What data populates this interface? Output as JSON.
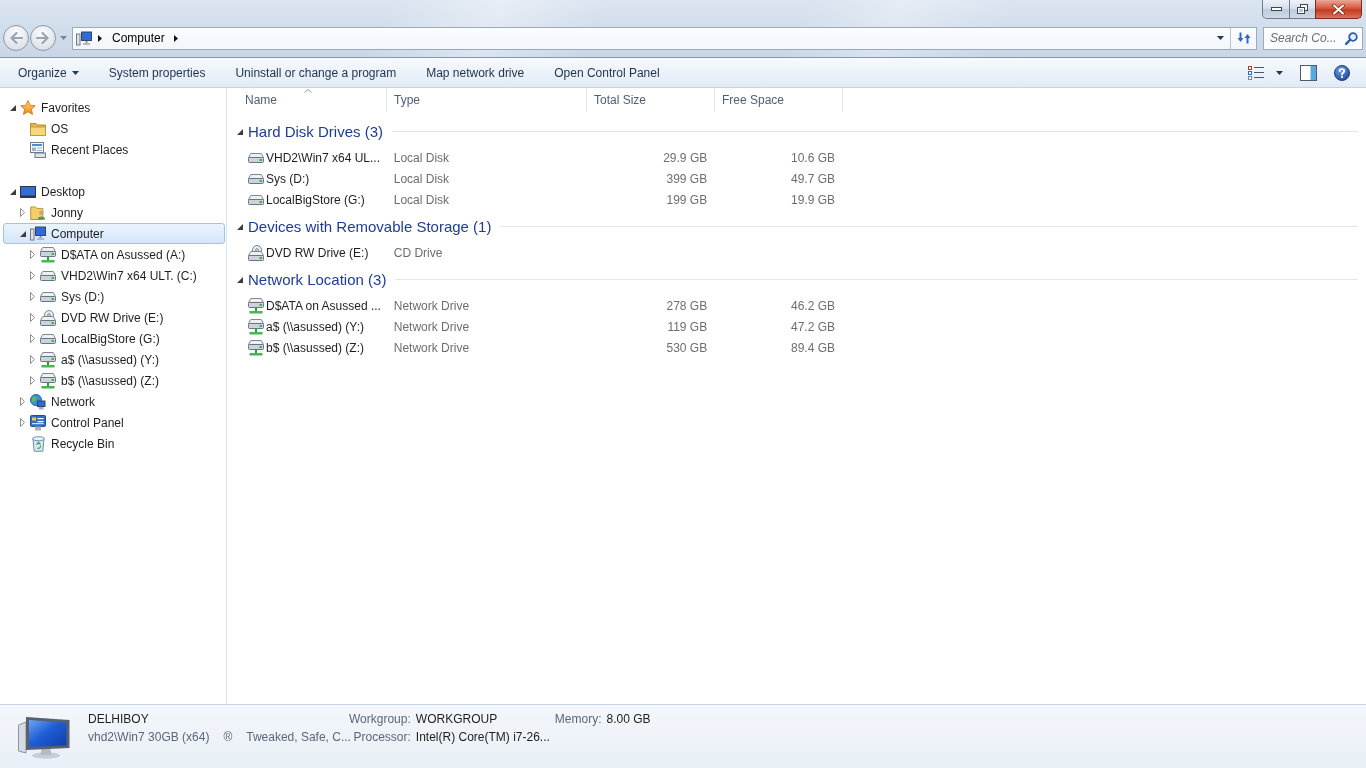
{
  "address_bar": {
    "nav_buttons": [
      {
        "kind": "back",
        "disabled": true
      },
      {
        "kind": "forward",
        "disabled": true
      }
    ],
    "crumbs": [
      {
        "label": "Computer"
      }
    ]
  },
  "search": {
    "placeholder": "Search Co..."
  },
  "command_bar": {
    "items": [
      {
        "label": "Organize",
        "kind": "menu"
      },
      {
        "label": "System properties",
        "kind": "button"
      },
      {
        "label": "Uninstall or change a program",
        "kind": "button"
      },
      {
        "label": "Map network drive",
        "kind": "button"
      },
      {
        "label": "Open Control Panel",
        "kind": "button"
      }
    ]
  },
  "navigation": {
    "sections": [
      {
        "label": "Favorites",
        "kind": "favorites",
        "expanded": true,
        "selected": false,
        "children": [
          {
            "label": "OS",
            "kind": "folder",
            "selected": false
          },
          {
            "label": "Recent Places",
            "kind": "recent",
            "selected": false
          }
        ]
      },
      {
        "label": "Desktop",
        "kind": "desktop",
        "expanded": true,
        "selected": false,
        "children": [
          {
            "label": "Jonny",
            "kind": "user-folder",
            "expanded": false,
            "selected": false
          },
          {
            "label": "Computer",
            "kind": "computer",
            "expanded": true,
            "selected": true,
            "children": [
              {
                "label": "D$ATA on Asussed (A:)",
                "kind": "network-drive",
                "expanded": false,
                "selected": false
              },
              {
                "label": "VHD2\\Win7 x64 ULT. (C:)",
                "kind": "disk",
                "expanded": false,
                "selected": false
              },
              {
                "label": "Sys (D:)",
                "kind": "disk",
                "expanded": false,
                "selected": false
              },
              {
                "label": "DVD RW Drive (E:)",
                "kind": "dvd",
                "expanded": false,
                "selected": false
              },
              {
                "label": "LocalBigStore (G:)",
                "kind": "disk",
                "expanded": false,
                "selected": false
              },
              {
                "label": "a$ (\\\\asussed) (Y:)",
                "kind": "network-drive",
                "expanded": false,
                "selected": false
              },
              {
                "label": "b$ (\\\\asussed) (Z:)",
                "kind": "network-drive",
                "expanded": false,
                "selected": false
              }
            ]
          },
          {
            "label": "Network",
            "kind": "network",
            "expanded": false,
            "selected": false
          },
          {
            "label": "Control Panel",
            "kind": "control-panel",
            "expanded": false,
            "selected": false
          },
          {
            "label": "Recycle Bin",
            "kind": "recycle-bin",
            "selected": false
          }
        ]
      }
    ]
  },
  "file_list": {
    "columns": [
      {
        "label": "Name",
        "sorted": true
      },
      {
        "label": "Type",
        "sorted": false
      },
      {
        "label": "Total Size",
        "sorted": false
      },
      {
        "label": "Free Space",
        "sorted": false
      }
    ],
    "groups": [
      {
        "title": "Hard Disk Drives (3)",
        "expanded": true,
        "items": [
          {
            "name": "VHD2\\Win7 x64 UL...",
            "kind": "disk",
            "type": "Local Disk",
            "total_size": "29.9 GB",
            "free_space": "10.6 GB",
            "selected": false
          },
          {
            "name": "Sys (D:)",
            "kind": "disk",
            "type": "Local Disk",
            "total_size": "399 GB",
            "free_space": "49.7 GB",
            "selected": false
          },
          {
            "name": "LocalBigStore (G:)",
            "kind": "disk",
            "type": "Local Disk",
            "total_size": "199 GB",
            "free_space": "19.9 GB",
            "selected": false
          }
        ]
      },
      {
        "title": "Devices with Removable Storage (1)",
        "expanded": true,
        "items": [
          {
            "name": "DVD RW Drive (E:)",
            "kind": "dvd",
            "type": "CD Drive",
            "selected": false
          }
        ]
      },
      {
        "title": "Network Location (3)",
        "expanded": true,
        "items": [
          {
            "name": "D$ATA on Asussed ...",
            "kind": "network-drive",
            "type": "Network Drive",
            "total_size": "278 GB",
            "free_space": "46.2 GB",
            "selected": false
          },
          {
            "name": "a$ (\\\\asussed) (Y:)",
            "kind": "network-drive",
            "type": "Network Drive",
            "total_size": "119 GB",
            "free_space": "47.2 GB",
            "selected": false
          },
          {
            "name": "b$ (\\\\asussed) (Z:)",
            "kind": "network-drive",
            "type": "Network Drive",
            "total_size": "530 GB",
            "free_space": "89.4 GB",
            "selected": false
          }
        ]
      }
    ]
  },
  "details_pane": {
    "name": "DELHIBOY",
    "description": "vhd2\\Win7 30GB (x64)",
    "symbol": "®",
    "comment": "Tweaked, Safe, C...",
    "properties": [
      {
        "label": "Workgroup:",
        "value": "WORKGROUP"
      },
      {
        "label": "Memory:",
        "value": "8.00 GB"
      },
      {
        "label": "Processor:",
        "value": "Intel(R) Core(TM) i7-26..."
      }
    ]
  }
}
